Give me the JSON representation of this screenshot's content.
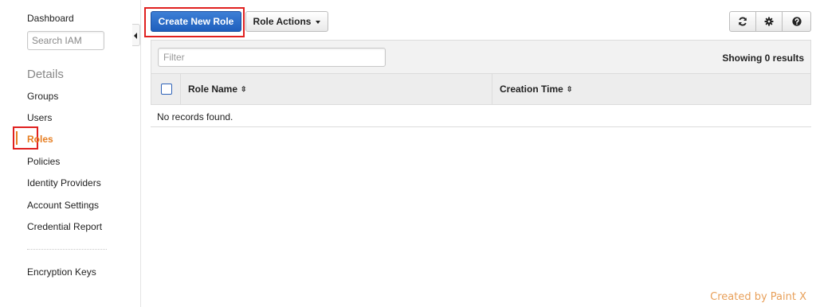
{
  "sidebar": {
    "dashboard": "Dashboard",
    "search_placeholder": "Search IAM",
    "details_heading": "Details",
    "items": [
      {
        "label": "Groups"
      },
      {
        "label": "Users"
      },
      {
        "label": "Roles",
        "active": true
      },
      {
        "label": "Policies"
      },
      {
        "label": "Identity Providers"
      },
      {
        "label": "Account Settings"
      },
      {
        "label": "Credential Report"
      }
    ],
    "encryption_keys": "Encryption Keys"
  },
  "toolbar": {
    "create_role_label": "Create New Role",
    "role_actions_label": "Role Actions",
    "icons": [
      "refresh-icon",
      "gear-icon",
      "help-icon"
    ]
  },
  "filter": {
    "placeholder": "Filter",
    "showing": "Showing 0 results"
  },
  "table": {
    "columns": [
      {
        "label": "Role Name",
        "sort_icon": "⇳"
      },
      {
        "label": "Creation Time",
        "sort_icon": "⇳"
      }
    ],
    "empty_message": "No records found."
  },
  "watermark": "Created by Paint X",
  "colors": {
    "primary": "#1f5fbd",
    "active_nav": "#e67e22",
    "highlight": "#e0201f"
  }
}
